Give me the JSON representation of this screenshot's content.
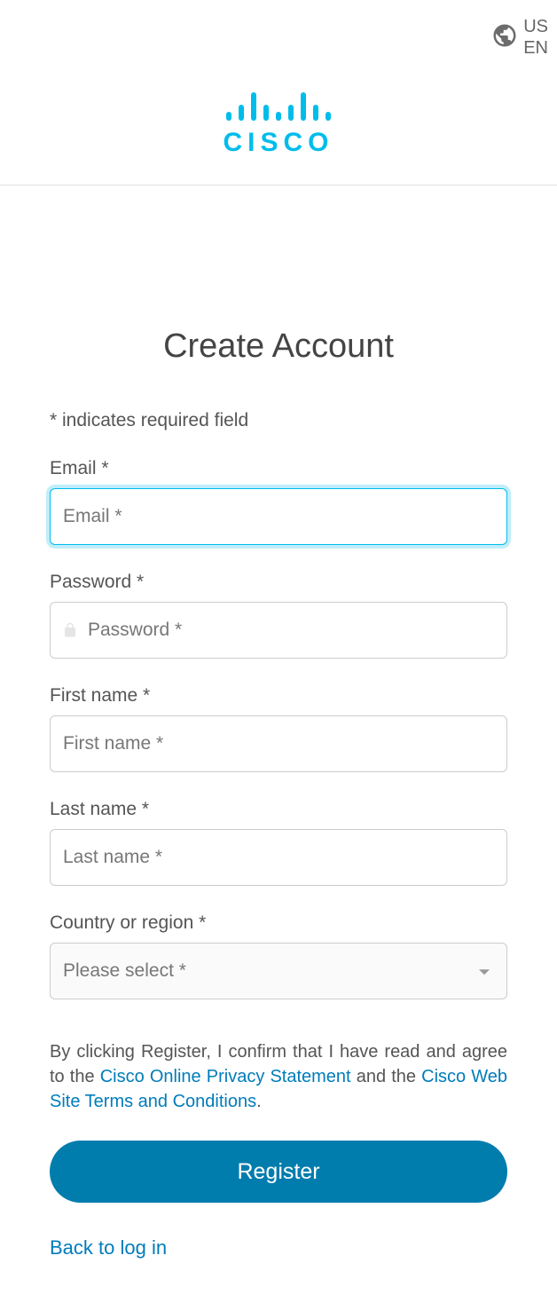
{
  "header": {
    "locale_country": "US",
    "locale_lang": "EN",
    "brand": "cisco"
  },
  "page": {
    "title": "Create Account",
    "required_note": "* indicates required field"
  },
  "form": {
    "email": {
      "label": "Email *",
      "placeholder": "Email *"
    },
    "password": {
      "label": "Password *",
      "placeholder": "Password *"
    },
    "first_name": {
      "label": "First name *",
      "placeholder": "First name *"
    },
    "last_name": {
      "label": "Last name *",
      "placeholder": "Last name *"
    },
    "country": {
      "label": "Country or region *",
      "placeholder": "Please select *"
    }
  },
  "terms": {
    "prefix": "By clicking Register, I confirm that I have read and agree to the ",
    "link1": "Cisco Online Privacy Statement",
    "mid": " and the ",
    "link2": "Cisco Web Site Terms and Conditions",
    "suffix": "."
  },
  "buttons": {
    "register": "Register",
    "back": "Back to log in"
  }
}
